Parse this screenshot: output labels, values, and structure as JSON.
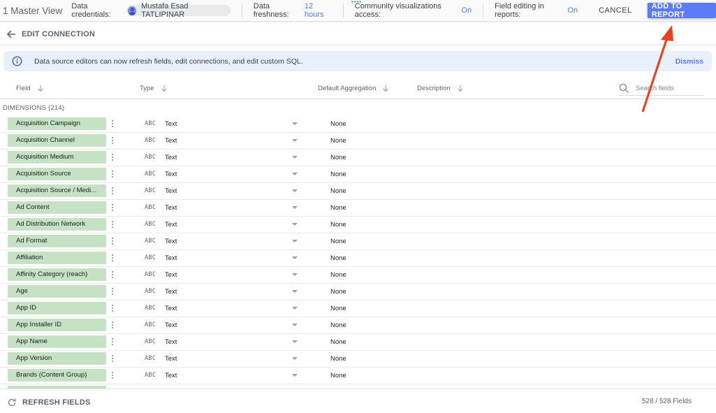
{
  "topbar": {
    "title": "1 Master View",
    "credentials_label": "Data credentials:",
    "credentials_user": "Mustafa Esad TATLIPINAR",
    "freshness_label": "Data freshness:",
    "freshness_value": "12 hours",
    "community_label": "Community visualizations access:",
    "community_value": "On",
    "field_editing_label": "Field editing in reports:",
    "field_editing_value": "On",
    "cancel_label": "CANCEL",
    "add_label": "ADD TO REPORT"
  },
  "subheader": {
    "title": "EDIT CONNECTION"
  },
  "banner": {
    "message": "Data source editors can now refresh fields, edit connections, and edit custom SQL.",
    "dismiss_label": "Dismiss"
  },
  "columns": {
    "field": "Field",
    "type": "Type",
    "default_aggregation": "Default Aggregation",
    "description": "Description",
    "search_placeholder": "Search fields"
  },
  "section": {
    "label": "DIMENSIONS (214)"
  },
  "type_icon_text": "ABC",
  "rows": [
    {
      "name": "Acquisition Campaign",
      "type": "Text",
      "aggregation": "None"
    },
    {
      "name": "Acquisition Channel",
      "type": "Text",
      "aggregation": "None"
    },
    {
      "name": "Acquisition Medium",
      "type": "Text",
      "aggregation": "None"
    },
    {
      "name": "Acquisition Source",
      "type": "Text",
      "aggregation": "None"
    },
    {
      "name": "Acquisition Source / Medi...",
      "type": "Text",
      "aggregation": "None"
    },
    {
      "name": "Ad Content",
      "type": "Text",
      "aggregation": "None"
    },
    {
      "name": "Ad Distribution Network",
      "type": "Text",
      "aggregation": "None"
    },
    {
      "name": "Ad Format",
      "type": "Text",
      "aggregation": "None"
    },
    {
      "name": "Affiliation",
      "type": "Text",
      "aggregation": "None"
    },
    {
      "name": "Affinity Category (reach)",
      "type": "Text",
      "aggregation": "None"
    },
    {
      "name": "Age",
      "type": "Text",
      "aggregation": "None"
    },
    {
      "name": "App ID",
      "type": "Text",
      "aggregation": "None"
    },
    {
      "name": "App Installer ID",
      "type": "Text",
      "aggregation": "None"
    },
    {
      "name": "App Name",
      "type": "Text",
      "aggregation": "None"
    },
    {
      "name": "App Version",
      "type": "Text",
      "aggregation": "None"
    },
    {
      "name": "Brands (Content Group)",
      "type": "Text",
      "aggregation": "None"
    },
    {
      "name": "",
      "type": "",
      "aggregation": ""
    }
  ],
  "footer": {
    "refresh_label": "REFRESH FIELDS",
    "field_count": "528 / 528 Fields"
  },
  "colors": {
    "accent": "#5b7bf8",
    "link": "#4285f4",
    "dimension_pill": "#c5e3c4",
    "banner_bg": "#e8f0fe",
    "annotation_arrow": "#e8431f"
  }
}
